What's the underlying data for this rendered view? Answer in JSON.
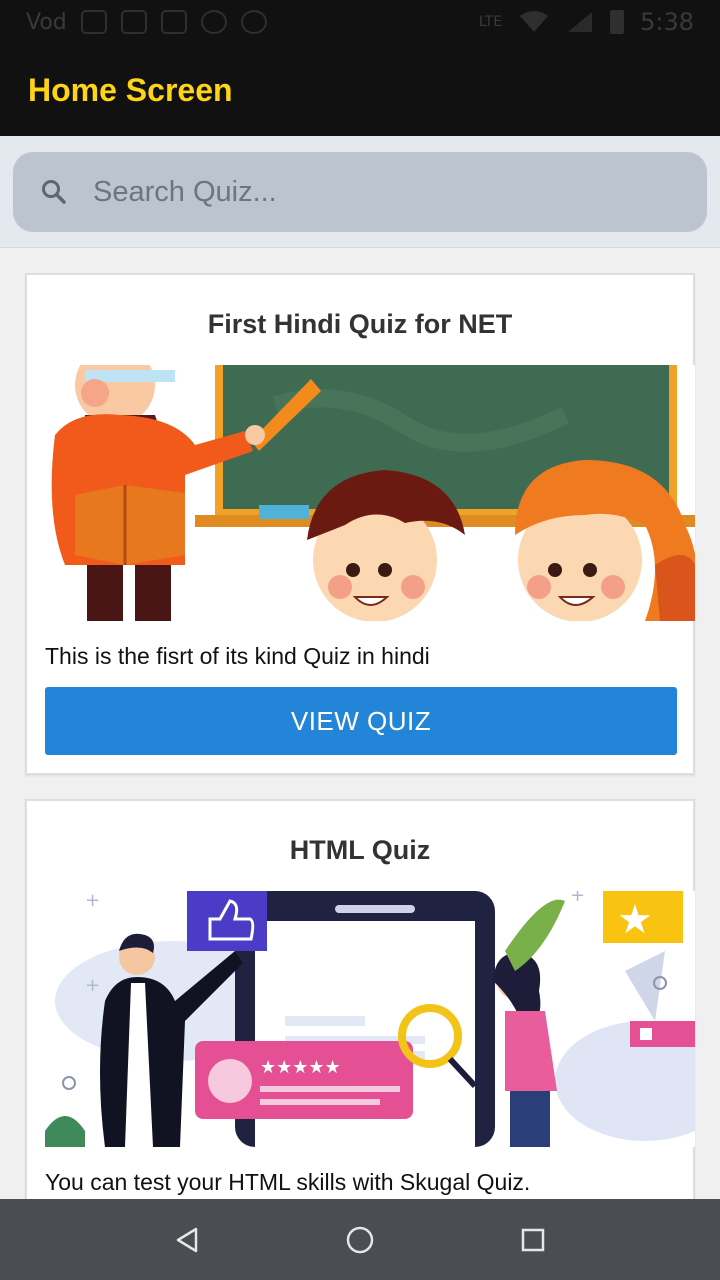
{
  "status_bar": {
    "carrier": "Vod",
    "network": "LTE",
    "time": "5:38"
  },
  "app_bar": {
    "title": "Home Screen"
  },
  "search": {
    "placeholder": "Search Quiz...",
    "icon": "search-icon"
  },
  "cards": [
    {
      "title": "First Hindi Quiz for NET",
      "description": "This is the fisrt of its kind Quiz in hindi",
      "button_label": "VIEW QUIZ",
      "image": "teacher-classroom-illustration"
    },
    {
      "title": "HTML Quiz",
      "description": "You can test your HTML skills with Skugal Quiz.",
      "image": "html-quiz-illustration"
    }
  ],
  "nav_bar": {
    "back_icon": "back-triangle-icon",
    "home_icon": "home-circle-icon",
    "recents_icon": "recents-square-icon"
  },
  "colors": {
    "app_bar_bg": "#111111",
    "title_yellow": "#ffd416",
    "button_blue": "#2385d8",
    "search_bg": "#bcc4cf",
    "nav_bg": "#4a4d52"
  }
}
